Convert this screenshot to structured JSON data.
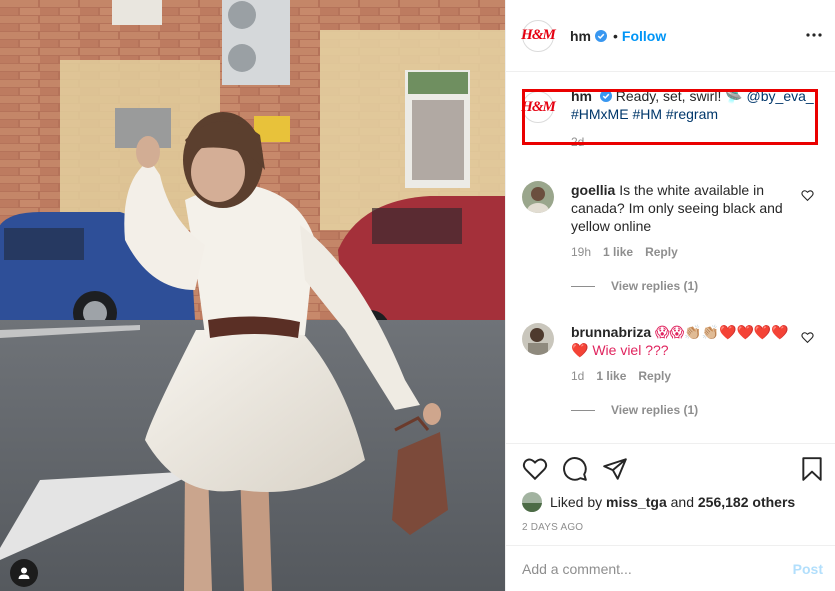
{
  "post": {
    "account": "hm",
    "follow_label": "Follow",
    "dot": "•",
    "logo_text": "H&M",
    "caption": {
      "username": "hm",
      "text_before": "Ready, set, swirl! 🛸 ",
      "mention": "@by_eva_",
      "hashtags": "#HMxME #HM #regram",
      "time": "2d"
    }
  },
  "comments": [
    {
      "username": "goellia",
      "text": "Is the white available in canada? Im only seeing black and yellow online",
      "time": "19h",
      "likes": "1 like",
      "reply": "Reply",
      "view_replies": "View replies (1)"
    },
    {
      "username": "brunnabriza",
      "text": "😱😱👏🏼👏🏼❤️❤️❤️❤️❤️ Wie viel ???",
      "time": "1d",
      "likes": "1 like",
      "reply": "Reply",
      "view_replies": "View replies (1)"
    }
  ],
  "likes": {
    "prefix": "Liked by",
    "user": "miss_tga",
    "and": "and",
    "others": "256,182 others"
  },
  "timestamp": "2 DAYS AGO",
  "add_comment": {
    "placeholder": "Add a comment...",
    "post_label": "Post"
  },
  "icons": {
    "verified": "verified-badge-icon",
    "more": "more-options-icon",
    "like": "heart-icon",
    "comment": "comment-bubble-icon",
    "share": "paper-plane-icon",
    "save": "bookmark-icon",
    "tagged": "tagged-user-icon"
  },
  "colors": {
    "accent": "#0095f6",
    "highlight": "#ea0000",
    "brand": "#e50010"
  }
}
